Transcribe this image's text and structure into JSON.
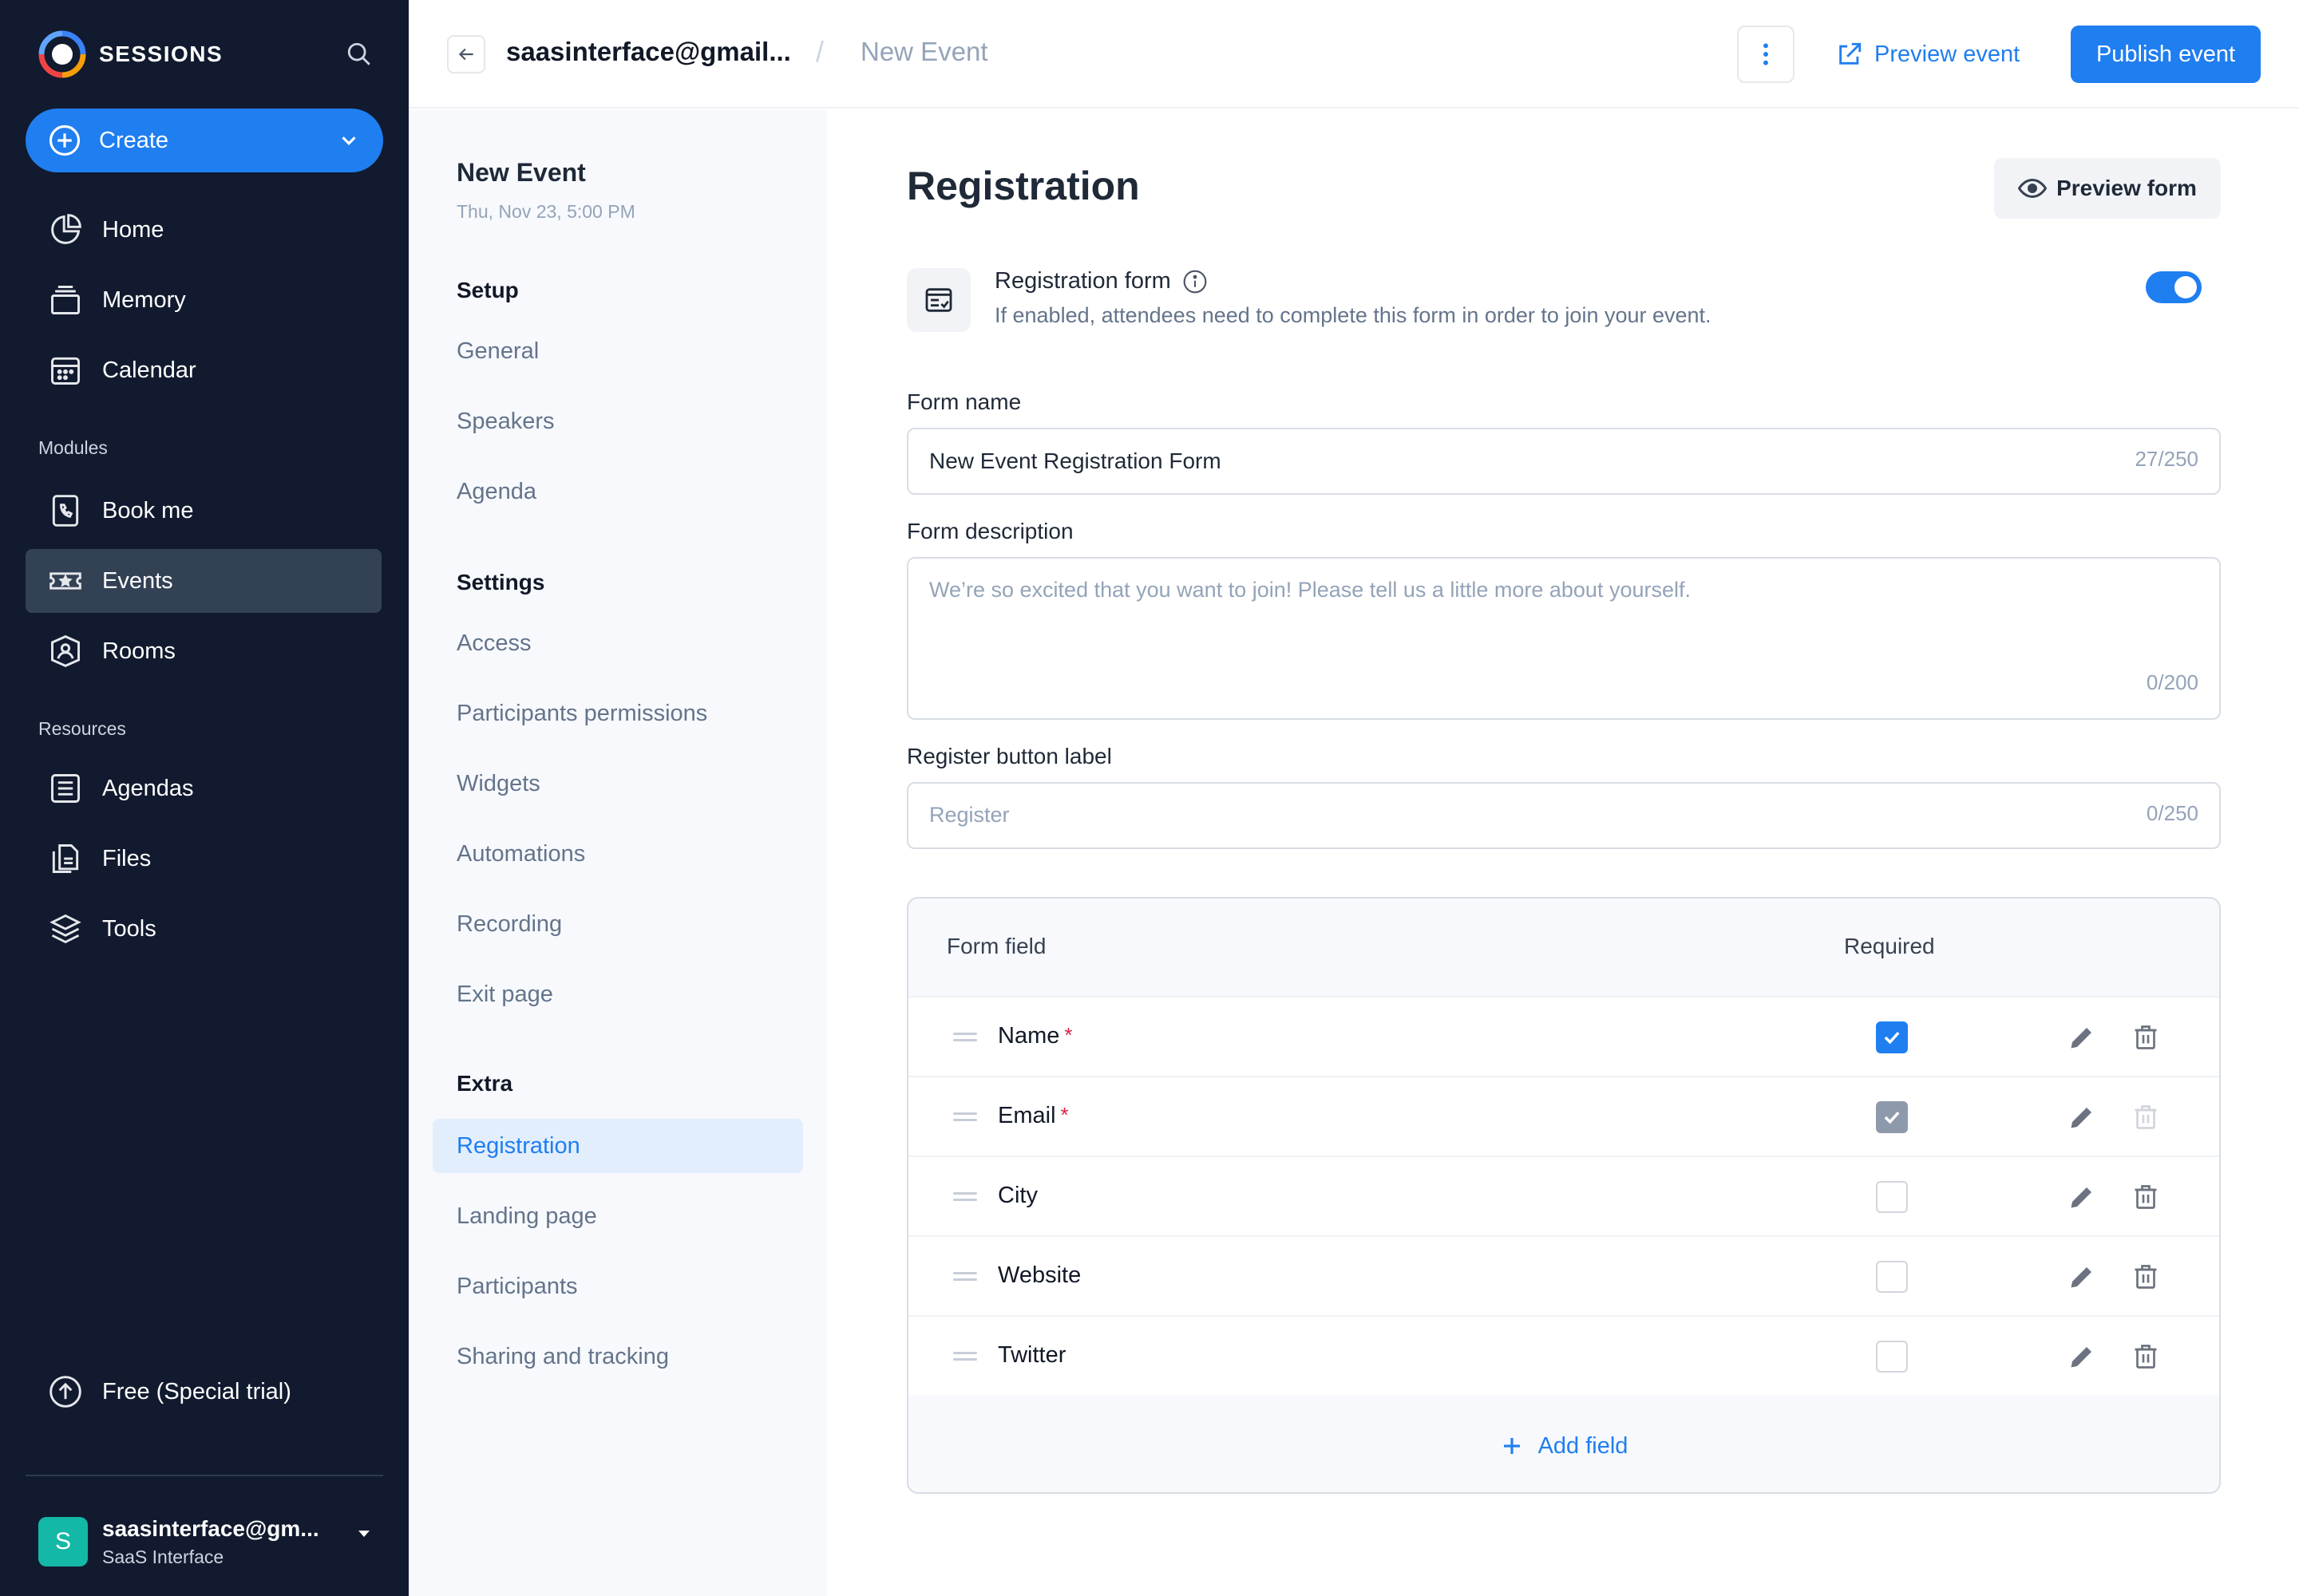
{
  "sidebar": {
    "brand": "SESSIONS",
    "create_label": "Create",
    "nav": [
      {
        "label": "Home",
        "icon": "home-chart-icon"
      },
      {
        "label": "Memory",
        "icon": "memory-icon"
      },
      {
        "label": "Calendar",
        "icon": "calendar-icon"
      }
    ],
    "modules_label": "Modules",
    "modules": [
      {
        "label": "Book me",
        "icon": "book-me-icon"
      },
      {
        "label": "Events",
        "icon": "ticket-icon",
        "active": true
      },
      {
        "label": "Rooms",
        "icon": "rooms-icon"
      }
    ],
    "resources_label": "Resources",
    "resources": [
      {
        "label": "Agendas",
        "icon": "agenda-icon"
      },
      {
        "label": "Files",
        "icon": "files-icon"
      },
      {
        "label": "Tools",
        "icon": "layers-icon"
      }
    ],
    "plan_label": "Free (Special trial)",
    "user": {
      "initial": "S",
      "name": "saasinterface@gm...",
      "org": "SaaS Interface"
    }
  },
  "header": {
    "account": "saasinterface@gmail...",
    "separator": "/",
    "page": "New Event",
    "preview_event_label": "Preview event",
    "publish_label": "Publish event"
  },
  "subnav": {
    "event_title": "New Event",
    "event_date": "Thu, Nov 23, 5:00 PM",
    "setup_label": "Setup",
    "setup": [
      "General",
      "Speakers",
      "Agenda"
    ],
    "settings_label": "Settings",
    "settings": [
      "Access",
      "Participants permissions",
      "Widgets",
      "Automations",
      "Recording",
      "Exit page"
    ],
    "extra_label": "Extra",
    "extra": [
      "Registration",
      "Landing page",
      "Participants",
      "Sharing and tracking"
    ],
    "active": "Registration"
  },
  "main": {
    "title": "Registration",
    "preview_form_label": "Preview form",
    "reg_form_title": "Registration form",
    "reg_form_desc": "If enabled, attendees need to complete this form in order to join your event.",
    "reg_form_enabled": true,
    "form_name_label": "Form name",
    "form_name_value": "New Event Registration Form",
    "form_name_count": "27/250",
    "form_desc_label": "Form description",
    "form_desc_placeholder": "We’re so excited that you want to join! Please tell us a little more about yourself.",
    "form_desc_count": "0/200",
    "register_label": "Register button label",
    "register_placeholder": "Register",
    "register_count": "0/250",
    "table": {
      "col_field": "Form field",
      "col_required": "Required",
      "rows": [
        {
          "name": "Name",
          "mandatory": true,
          "required": true,
          "locked": false
        },
        {
          "name": "Email",
          "mandatory": true,
          "required": true,
          "locked": true
        },
        {
          "name": "City",
          "mandatory": false,
          "required": false,
          "locked": false
        },
        {
          "name": "Website",
          "mandatory": false,
          "required": false,
          "locked": false
        },
        {
          "name": "Twitter",
          "mandatory": false,
          "required": false,
          "locked": false
        }
      ],
      "star": "*",
      "add_field_label": "Add field"
    }
  },
  "colors": {
    "sidebar_bg": "#111a2e",
    "accent": "#1f7ef0",
    "active_nav": "#334155",
    "subnav_bg": "#f7f9fc",
    "required_star": "#e11d48"
  }
}
